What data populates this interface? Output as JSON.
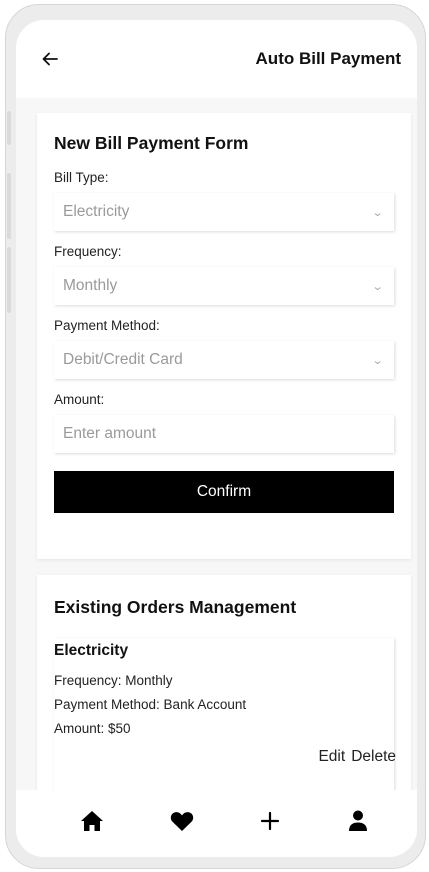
{
  "header": {
    "title": "Auto Bill Payment",
    "back_icon": "arrow-left-icon"
  },
  "form": {
    "title": "New Bill Payment Form",
    "bill_type": {
      "label": "Bill Type:",
      "value": "Electricity"
    },
    "frequency": {
      "label": "Frequency:",
      "value": "Monthly"
    },
    "payment_method": {
      "label": "Payment Method:",
      "value": "Debit/Credit Card"
    },
    "amount": {
      "label": "Amount:",
      "placeholder": "Enter amount"
    },
    "confirm_label": "Confirm"
  },
  "orders": {
    "title": "Existing Orders Management",
    "items": [
      {
        "name": "Electricity",
        "frequency": "Frequency: Monthly",
        "payment_method": "Payment Method: Bank Account",
        "amount": "Amount: $50",
        "edit_label": "Edit",
        "delete_label": "Delete"
      }
    ]
  },
  "nav": {
    "items": [
      {
        "icon": "home-icon"
      },
      {
        "icon": "heart-icon"
      },
      {
        "icon": "plus-icon"
      },
      {
        "icon": "user-icon"
      }
    ]
  },
  "colors": {
    "accent": "#000000",
    "background": "#f7f7f7",
    "card": "#ffffff",
    "placeholder": "#9a9a9a"
  }
}
